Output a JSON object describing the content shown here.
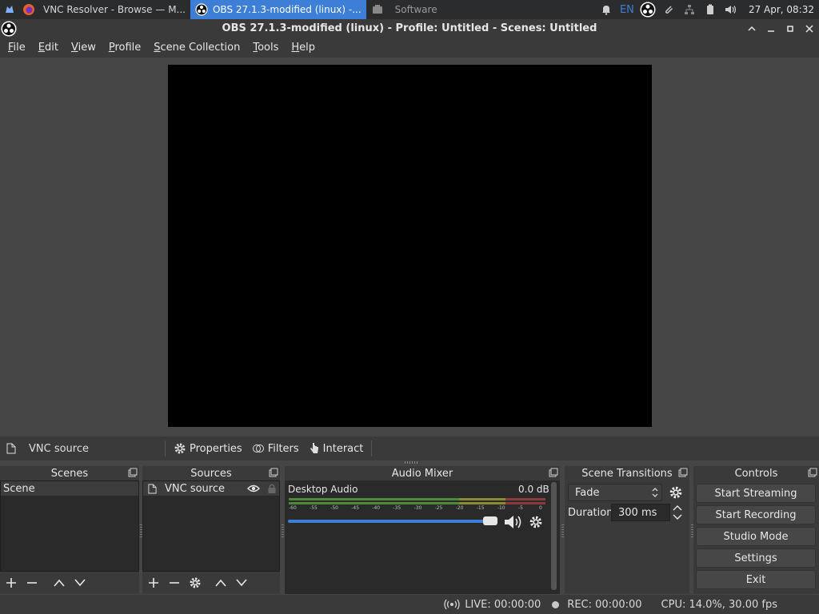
{
  "taskbar": {
    "tasks": [
      {
        "label": "VNC Resolver - Browse — M..."
      },
      {
        "label": "OBS 27.1.3-modified (linux) -..."
      },
      {
        "label": "Software"
      }
    ],
    "tray": {
      "lang": "EN",
      "clock": "27 Apr, 08:32"
    }
  },
  "window": {
    "title": "OBS 27.1.3-modified (linux) - Profile: Untitled - Scenes: Untitled"
  },
  "menu": {
    "items": [
      "File",
      "Edit",
      "View",
      "Profile",
      "Scene Collection",
      "Tools",
      "Help"
    ]
  },
  "source_toolbar": {
    "current_source": "VNC source",
    "properties": "Properties",
    "filters": "Filters",
    "interact": "Interact"
  },
  "docks": {
    "scenes": {
      "title": "Scenes",
      "items": [
        "Scene"
      ]
    },
    "sources": {
      "title": "Sources",
      "items": [
        "VNC source"
      ]
    },
    "mixer": {
      "title": "Audio Mixer",
      "channel": "Desktop Audio",
      "db": "0.0 dB",
      "ticks": [
        "-60",
        "-55",
        "-50",
        "-45",
        "-40",
        "-35",
        "-30",
        "-25",
        "-20",
        "-15",
        "-10",
        "-5",
        "0"
      ],
      "volume_level": 1.0
    },
    "transitions": {
      "title": "Scene Transitions",
      "selected": "Fade",
      "duration_label": "Duration",
      "duration_value": "300 ms"
    },
    "controls": {
      "title": "Controls",
      "buttons": [
        "Start Streaming",
        "Start Recording",
        "Studio Mode",
        "Settings",
        "Exit"
      ]
    }
  },
  "status": {
    "live": "LIVE: 00:00:00",
    "rec": "REC: 00:00:00",
    "cpu": "CPU: 14.0%, 30.00 fps"
  },
  "colors": {
    "accent": "#3d7fd6",
    "preview_bg": "#000000"
  }
}
